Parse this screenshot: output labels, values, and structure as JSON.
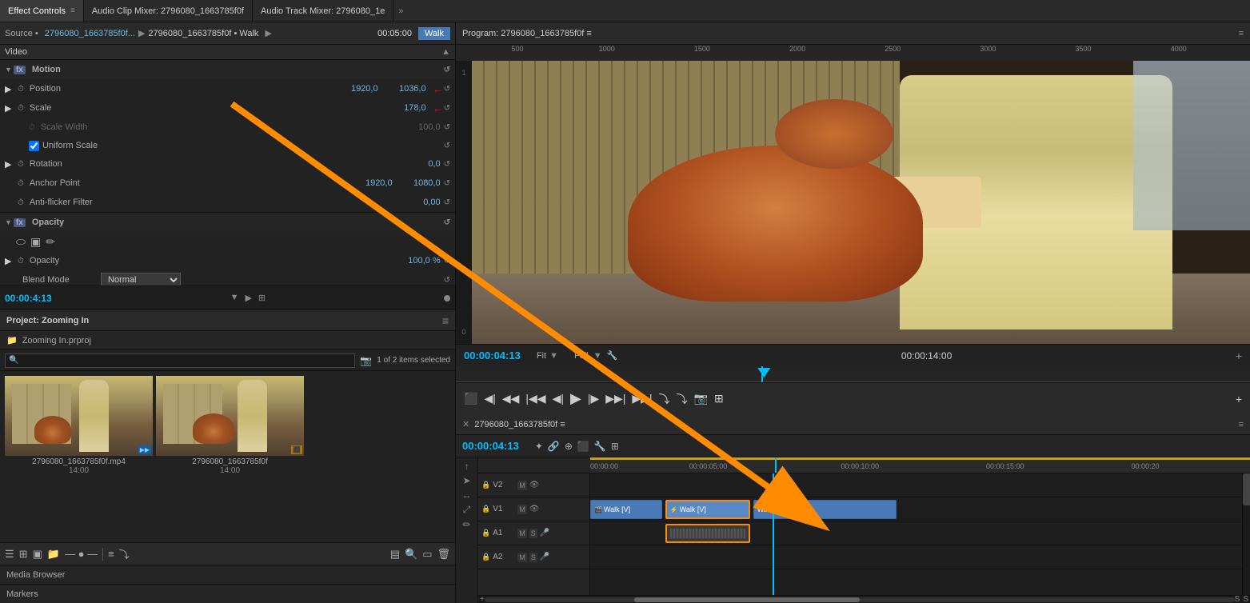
{
  "tabs": {
    "effect_controls": "Effect Controls",
    "audio_clip_mixer": "Audio Clip Mixer: 2796080_1663785f0f",
    "audio_track_mixer": "Audio Track Mixer: 2796080_1e",
    "more_tabs": "»"
  },
  "effect_controls": {
    "source_label": "Source •",
    "source_clip": "2796080_1663785f0f...",
    "source_arrow": "▶",
    "sequence_name": "2796080_1663785f0f • Walk",
    "timecode": "00:05:00",
    "clip_name": "Walk",
    "video_section": "Video",
    "motion_group": {
      "label": "Motion",
      "position_label": "Position",
      "position_x": "1920,0",
      "position_y": "1036,0",
      "scale_label": "Scale",
      "scale_value": "178,0",
      "scale_width_label": "Scale Width",
      "scale_width_value": "100,0",
      "uniform_scale_label": "Uniform Scale",
      "rotation_label": "Rotation",
      "rotation_value": "0,0",
      "anchor_label": "Anchor Point",
      "anchor_x": "1920,0",
      "anchor_y": "1080,0",
      "anti_flicker_label": "Anti-flicker Filter",
      "anti_flicker_value": "0,00"
    },
    "opacity_group": {
      "label": "Opacity",
      "opacity_label": "Opacity",
      "opacity_value": "100,0 %",
      "blend_label": "Blend Mode",
      "blend_value": "Normal"
    }
  },
  "timeline_bar": {
    "timecode": "00:00:4:13"
  },
  "project": {
    "title": "Project: Zooming In",
    "file_name": "Zooming In.prproj",
    "items_selected": "1 of 2 items selected",
    "search_placeholder": "🔍",
    "clips": [
      {
        "name": "2796080_1663785f0f.mp4",
        "duration": "14:00",
        "has_video": true
      },
      {
        "name": "2796080_1663785f0f",
        "duration": "14:00",
        "is_sequence": true
      }
    ]
  },
  "bottom_toolbar": {
    "icons": [
      "list",
      "icon2",
      "icon3",
      "icon4",
      "slider",
      "icon5",
      "icon6",
      "icon7",
      "icon8"
    ]
  },
  "media_browser": "Media Browser",
  "markers": "Markers",
  "program_monitor": {
    "title": "Program: 2796080_1663785f0f ≡",
    "timecode": "00:00:04:13",
    "quality": "Full",
    "duration": "00:00:14:00",
    "ruler_marks": [
      "500",
      "1000",
      "1500",
      "2000",
      "2500",
      "3000",
      "3500",
      "4000"
    ]
  },
  "timeline": {
    "title": "2796080_1663785f0f ≡",
    "timecode": "00:00:04:13",
    "ruler_marks": [
      "00:00:00",
      "00:00:05:00",
      "00:00:10:00",
      "00:00:15:00",
      "00:00:20"
    ],
    "tracks": [
      {
        "name": "V2",
        "type": "video"
      },
      {
        "name": "V1",
        "type": "video"
      },
      {
        "name": "A1",
        "type": "audio"
      },
      {
        "name": "A2",
        "type": "audio"
      }
    ],
    "clips": {
      "v1_clips": [
        {
          "label": "Walk [V]",
          "start_pct": 0,
          "width_pct": 12,
          "selected": false
        },
        {
          "label": "Walk [V]",
          "start_pct": 12,
          "width_pct": 14,
          "selected": true,
          "has_fx": true
        },
        {
          "label": "Walk [V]",
          "start_pct": 27,
          "width_pct": 22,
          "selected": false
        }
      ],
      "a1_clips": [
        {
          "label": "",
          "start_pct": 12,
          "width_pct": 14,
          "selected": true
        }
      ]
    }
  }
}
